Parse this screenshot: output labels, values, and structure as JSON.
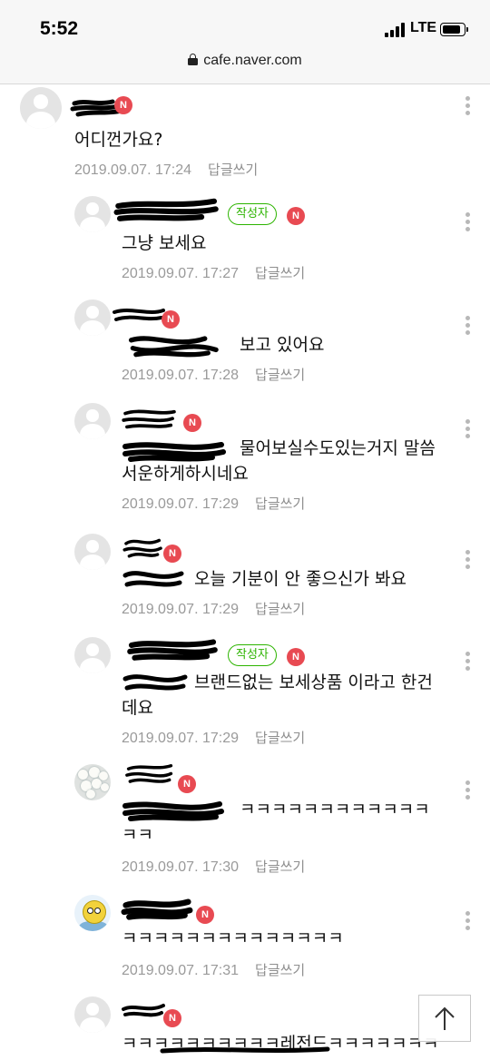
{
  "status_bar": {
    "time": "5:52",
    "network": "LTE"
  },
  "browser": {
    "url": "cafe.naver.com"
  },
  "comments": [
    {
      "text": "어디껀가요?",
      "date": "2019.09.07. 17:24",
      "reply": "답글쓰기",
      "new_badge": "N"
    },
    {
      "text": "그냥 보세요",
      "date": "2019.09.07. 17:27",
      "reply": "답글쓰기",
      "writer_badge": "작성자",
      "new_badge": "N"
    },
    {
      "text": "보고 있어요",
      "date": "2019.09.07. 17:28",
      "reply": "답글쓰기",
      "new_badge": "N"
    },
    {
      "text_line1": "물어보실수도있는거지 말씀",
      "text_line2": "서운하게하시네요",
      "date": "2019.09.07. 17:29",
      "reply": "답글쓰기",
      "new_badge": "N"
    },
    {
      "text": "오늘 기분이 안 좋으신가 봐요",
      "date": "2019.09.07. 17:29",
      "reply": "답글쓰기",
      "new_badge": "N"
    },
    {
      "text_line1": "브랜드없는 보세상품 이라고 한건",
      "text_line2": "데요",
      "date": "2019.09.07. 17:29",
      "reply": "답글쓰기",
      "writer_badge": "작성자",
      "new_badge": "N"
    },
    {
      "text_line1": "ㅋㅋㅋㅋㅋㅋㅋㅋㅋㅋㅋㅋ",
      "text_line2": "ㅋㅋ",
      "date": "2019.09.07. 17:30",
      "reply": "답글쓰기",
      "new_badge": "N"
    },
    {
      "text": "ㅋㅋㅋㅋㅋㅋㅋㅋㅋㅋㅋㅋㅋㅋ",
      "date": "2019.09.07. 17:31",
      "reply": "답글쓰기",
      "new_badge": "N"
    },
    {
      "text": "ㅋㅋㅋㅋㅋㅋㅋㅋㅋㅋ레전드ㅋㅋㅋㅋㅋㅋㅋ",
      "new_badge": "N"
    }
  ],
  "icons": {
    "lock": "lock-icon",
    "more": "more-vertical-icon",
    "scroll_top": "arrow-up-icon",
    "avatar": "default-profile-icon"
  },
  "colors": {
    "writer_badge": "#2db400",
    "new_badge": "#e84a52",
    "meta_text": "#9a9a9a"
  }
}
